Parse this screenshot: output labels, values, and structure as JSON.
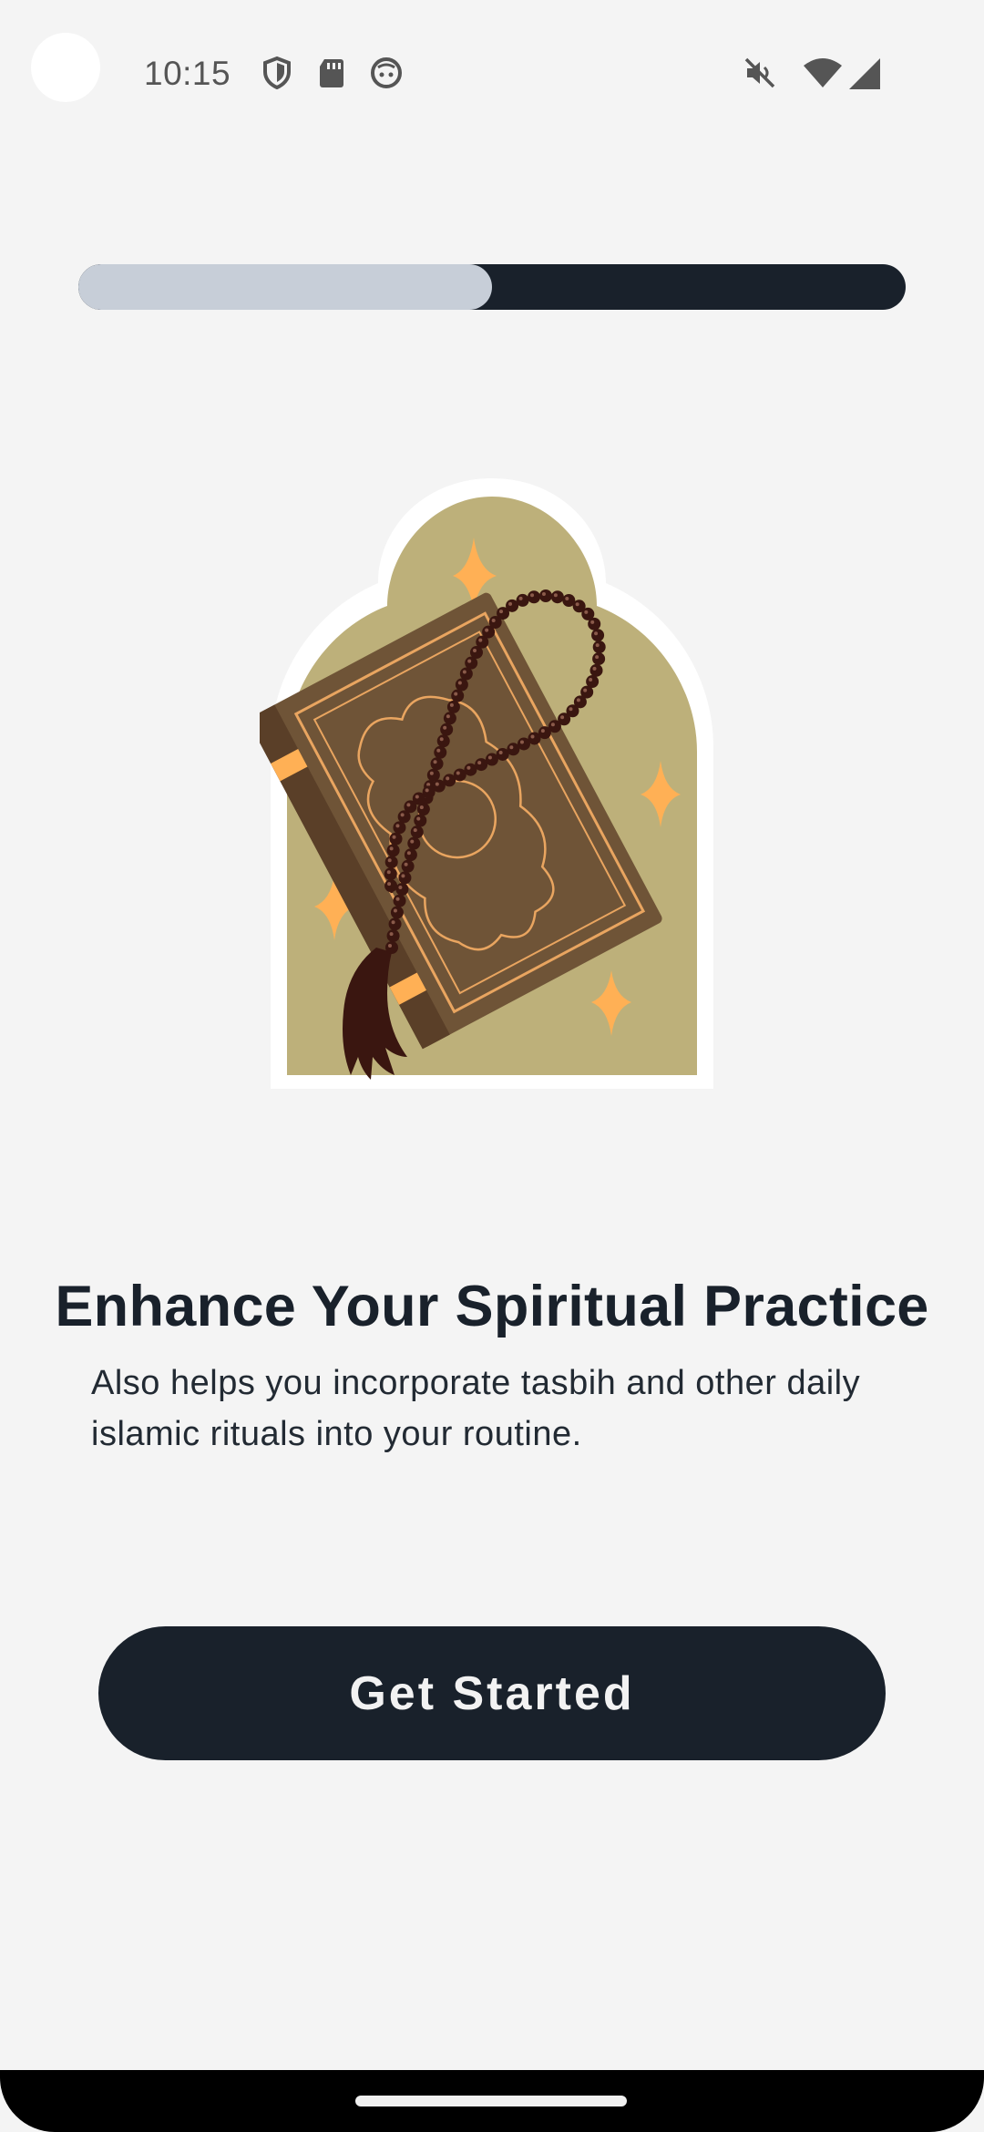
{
  "status_bar": {
    "time": "10:15",
    "left_icons": [
      "shield-icon",
      "sd-card-icon",
      "face-icon"
    ],
    "right_icons": [
      "mute-icon",
      "wifi-icon",
      "signal-icon"
    ]
  },
  "progress": {
    "fraction": 0.5
  },
  "illustration": {
    "name": "quran-with-tasbih-beads"
  },
  "onboarding": {
    "title": "Enhance Your Spiritual Practice",
    "description": "Also helps you incorporate tasbih and other daily islamic rituals into your routine.",
    "cta_label": "Get Started"
  },
  "colors": {
    "background": "#f4f4f4",
    "dark": "#19212b",
    "progress_fill": "#c7ced8",
    "arch": "#bdb07a",
    "book": "#6f5437",
    "accent": "#ffb055",
    "beads": "#3a1610"
  }
}
